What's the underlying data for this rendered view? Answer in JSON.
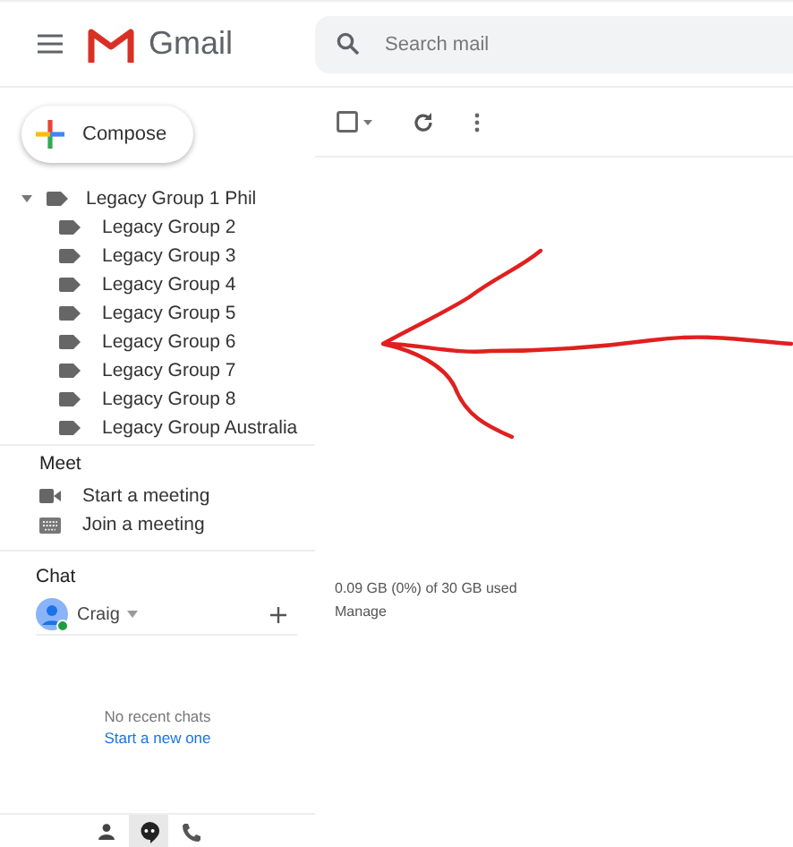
{
  "header": {
    "logo_text": "Gmail",
    "search": {
      "placeholder": "Search mail"
    }
  },
  "compose": {
    "label": "Compose"
  },
  "toolbar": {
    "select_all": {
      "checked": false
    }
  },
  "labels": [
    {
      "name": "Legacy Group 1 Phil",
      "expanded": true,
      "children": [
        {
          "name": "Legacy Group 2"
        },
        {
          "name": "Legacy Group 3"
        },
        {
          "name": "Legacy Group 4"
        },
        {
          "name": "Legacy Group 5"
        },
        {
          "name": "Legacy Group 6"
        },
        {
          "name": "Legacy Group 7"
        },
        {
          "name": "Legacy Group 8"
        },
        {
          "name": "Legacy Group Australia"
        }
      ]
    }
  ],
  "meet": {
    "title": "Meet",
    "items": [
      {
        "kind": "video",
        "label": "Start a meeting"
      },
      {
        "kind": "keyboard",
        "label": "Join a meeting"
      }
    ]
  },
  "chat": {
    "title": "Chat",
    "user": {
      "name": "Craig",
      "online": true
    },
    "empty_text": "No recent chats",
    "start_link": "Start a new one"
  },
  "storage": {
    "usage": "0.09 GB (0%) of 30 GB used",
    "manage": "Manage"
  },
  "bottom_tabs": [
    {
      "kind": "person",
      "selected": false
    },
    {
      "kind": "chat",
      "selected": true
    },
    {
      "kind": "phone",
      "selected": false
    }
  ]
}
